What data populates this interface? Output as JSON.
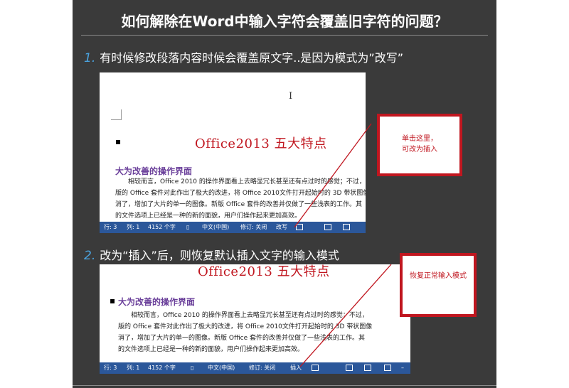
{
  "title": "如何解除在Word中输入字符会覆盖旧字符的问题？",
  "steps": [
    {
      "num": "1.",
      "text": "有时候修改段落内容时候会覆盖原文字..是因为模式为”改写”"
    },
    {
      "num": "2.",
      "text": "改为“插入”后，则恢复默认插入文字的输入模式"
    }
  ],
  "doc": {
    "title": "Office2013 五大特点",
    "heading": "大为改善的操作界面",
    "lines": [
      "相较而言，Office 2010 的操作界面看上去略显冗长甚至还有点过时的感觉；不过，",
      "版的 Office 套件对此作出了极大的改进，将 Office 2010文件打开起始时的 3D 带状图像",
      "消了，增加了大片的单一的图像。新版 Office 套件的改善并仅做了一些浅表的工作。其",
      "的文件选项上已经是一种的新的面貌，用户们操作起来更加高效。"
    ]
  },
  "status1": {
    "row": "行: 3",
    "col": "列: 1",
    "chars": "4152 个字",
    "lang": "中文(中国)",
    "rev": "修订: 关闭",
    "mode": "改写"
  },
  "status2": {
    "row": "行: 3",
    "col": "列: 1",
    "chars": "4152 个字",
    "lang": "中文(中国)",
    "rev": "修订: 关闭",
    "mode": "插入"
  },
  "callouts": [
    {
      "line1": "单击这里，",
      "line2": "可改为插入"
    },
    {
      "line1": "恢复正常输入模式"
    }
  ],
  "colors": {
    "panel": "#3a3a3a",
    "accent": "#4aa3df",
    "word_blue": "#2b579a",
    "callout_red": "#c0161f"
  }
}
